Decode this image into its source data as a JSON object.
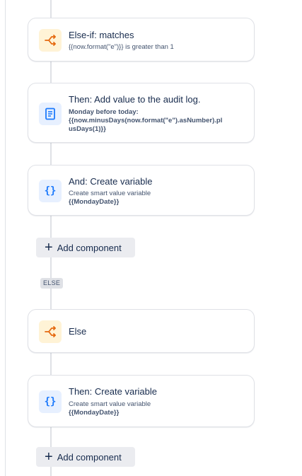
{
  "components": [
    {
      "kind": "branch",
      "title": "Else-if: matches",
      "lines": [
        "{{now.format(\"e\")}} is greater than 1"
      ],
      "icon": "branch-icon"
    },
    {
      "kind": "action",
      "title": "Then: Add value to the audit log.",
      "lines": [
        "Monday before today:",
        "{{now.minusDays(now.format(\"e\").asNumber).pl",
        "usDays(1)}}"
      ],
      "icon": "document-icon"
    },
    {
      "kind": "variable",
      "title": "And: Create variable",
      "lines": [
        "Create smart value variable",
        "{{MondayDate}}"
      ],
      "icon": "braces-icon"
    },
    {
      "kind": "branch",
      "title": "Else",
      "lines": [],
      "icon": "branch-icon"
    },
    {
      "kind": "variable",
      "title": "Then: Create variable",
      "lines": [
        "Create smart value variable",
        "{{MondayDate}}"
      ],
      "icon": "braces-icon"
    }
  ],
  "add_component_label": "Add component",
  "else_label": "ELSE",
  "colors": {
    "branch_icon": "#e56910",
    "branch_bg": "#fff3d6",
    "action_icon": "#1d7afc",
    "action_bg": "#e7f0ff"
  }
}
